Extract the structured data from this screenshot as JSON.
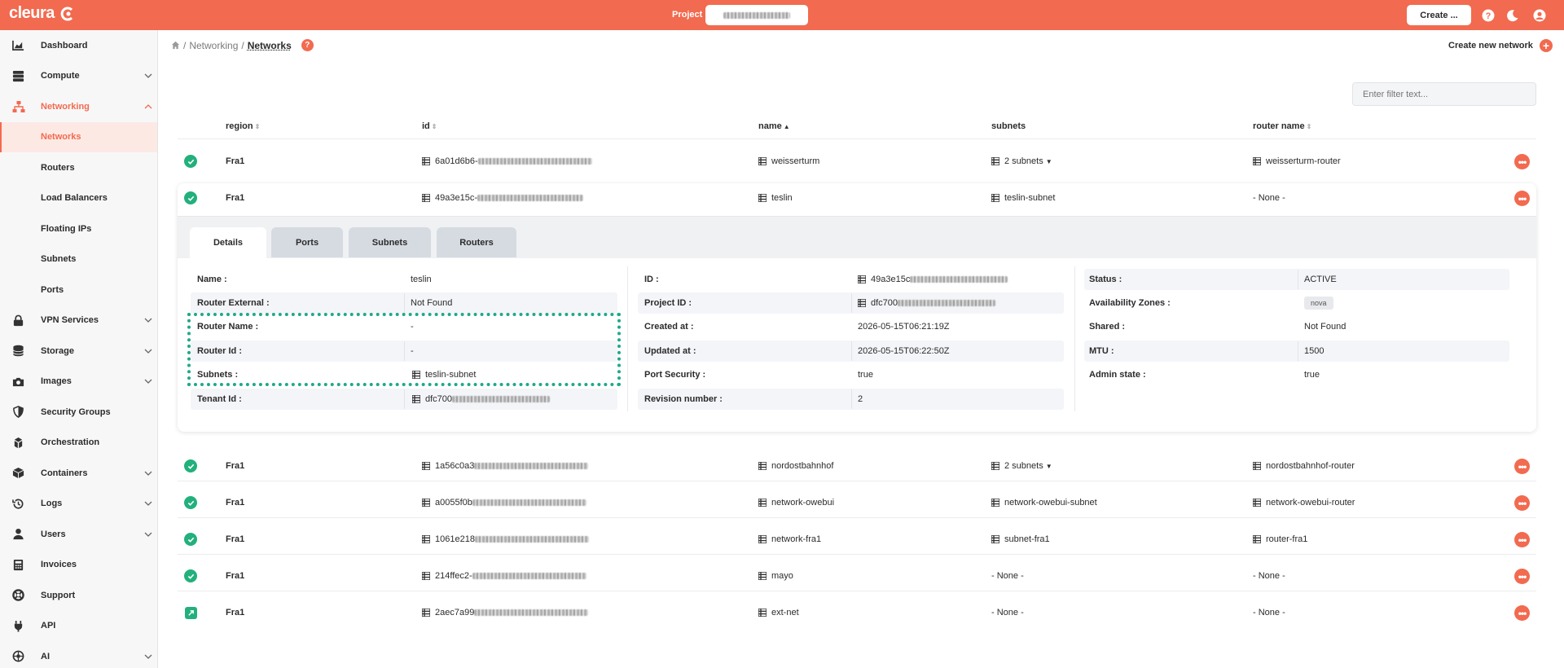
{
  "topbar": {
    "logo_text": "cleura",
    "project_label": "Project",
    "create_label": "Create ...",
    "accent_color": "#f26a4f"
  },
  "sidebar": {
    "items": [
      {
        "label": "Dashboard",
        "icon": "chart-area-icon",
        "chevron": false
      },
      {
        "label": "Compute",
        "icon": "server-icon",
        "chevron": true
      },
      {
        "label": "Networking",
        "icon": "network-icon",
        "chevron": true,
        "expanded": true
      },
      {
        "label": "VPN Services",
        "icon": "lock-icon",
        "chevron": true
      },
      {
        "label": "Storage",
        "icon": "database-icon",
        "chevron": true
      },
      {
        "label": "Images",
        "icon": "camera-icon",
        "chevron": true
      },
      {
        "label": "Security Groups",
        "icon": "shield-icon",
        "chevron": false
      },
      {
        "label": "Orchestration",
        "icon": "cubes-icon",
        "chevron": false
      },
      {
        "label": "Containers",
        "icon": "box-icon",
        "chevron": true
      },
      {
        "label": "Logs",
        "icon": "history-icon",
        "chevron": true
      },
      {
        "label": "Users",
        "icon": "user-icon",
        "chevron": true
      },
      {
        "label": "Invoices",
        "icon": "calculator-icon",
        "chevron": false
      },
      {
        "label": "Support",
        "icon": "lifebuoy-icon",
        "chevron": false
      },
      {
        "label": "API",
        "icon": "plug-icon",
        "chevron": false
      },
      {
        "label": "AI",
        "icon": "brain-icon",
        "chevron": true
      }
    ],
    "networking_sub": [
      "Networks",
      "Routers",
      "Load Balancers",
      "Floating IPs",
      "Subnets",
      "Ports"
    ]
  },
  "breadcrumb": {
    "first": "Networking",
    "current": "Networks",
    "sep": "/"
  },
  "help_badge": "?",
  "create_network_label": "Create new network",
  "filter_placeholder": "Enter filter text...",
  "table": {
    "headers": {
      "region": "region",
      "id": "id",
      "name": "name",
      "subnets": "subnets",
      "router_name": "router name"
    },
    "rows": [
      {
        "region": "Fra1",
        "id": "6a01d6b6-",
        "name": "weisserturm",
        "subnets": "2 subnets",
        "subnets_dropdown": true,
        "router": "weisserturm-router",
        "router_icon": true
      },
      {
        "region": "Fra1",
        "id": "49a3e15c-",
        "name": "teslin",
        "subnets": "teslin-subnet",
        "subnets_dropdown": false,
        "router": "- None -",
        "router_icon": false
      },
      {
        "region": "Fra1",
        "id": "1a56c0a3",
        "name": "nordostbahnhof",
        "subnets": "2 subnets",
        "subnets_dropdown": true,
        "router": "nordostbahnhof-router",
        "router_icon": true
      },
      {
        "region": "Fra1",
        "id": "a0055f0b",
        "name": "network-owebui",
        "subnets": "network-owebui-subnet",
        "subnets_dropdown": false,
        "router": "network-owebui-router",
        "router_icon": true
      },
      {
        "region": "Fra1",
        "id": "1061e218",
        "name": "network-fra1",
        "subnets": "subnet-fra1",
        "subnets_dropdown": false,
        "router": "router-fra1",
        "router_icon": true
      },
      {
        "region": "Fra1",
        "id": "214ffec2-",
        "name": "mayo",
        "subnets": "- None -",
        "subnets_dropdown": false,
        "router": "- None -",
        "router_icon": false
      },
      {
        "region": "Fra1",
        "id": "2aec7a99",
        "name": "ext-net",
        "subnets": "- None -",
        "subnets_dropdown": false,
        "router": "- None -",
        "router_icon": false
      }
    ]
  },
  "details": {
    "tabs": [
      "Details",
      "Ports",
      "Subnets",
      "Routers"
    ],
    "col1": [
      {
        "label": "Name :",
        "value": "teslin"
      },
      {
        "label": "Router External :",
        "value": "Not Found"
      },
      {
        "label": "Router Name :",
        "value": "-"
      },
      {
        "label": "Router Id :",
        "value": "-"
      },
      {
        "label": "Subnets :",
        "value": "teslin-subnet"
      },
      {
        "label": "Tenant Id :",
        "value": "dfc700"
      }
    ],
    "col2": [
      {
        "label": "ID :",
        "value": "49a3e15c"
      },
      {
        "label": "Project ID :",
        "value": "dfc700"
      },
      {
        "label": "Created at :",
        "value": "2026-05-15T06:21:19Z"
      },
      {
        "label": "Updated at :",
        "value": "2026-05-15T06:22:50Z"
      },
      {
        "label": "Port Security :",
        "value": "true"
      },
      {
        "label": "Revision number :",
        "value": "2"
      }
    ],
    "col3": [
      {
        "label": "Status :",
        "value": "ACTIVE"
      },
      {
        "label": "Availability Zones :",
        "value": "nova"
      },
      {
        "label": "Shared :",
        "value": "Not Found"
      },
      {
        "label": "MTU :",
        "value": "1500"
      },
      {
        "label": "Admin state :",
        "value": "true"
      }
    ]
  },
  "status_color": "#22b07d",
  "highlight_color": "#1fa88a"
}
